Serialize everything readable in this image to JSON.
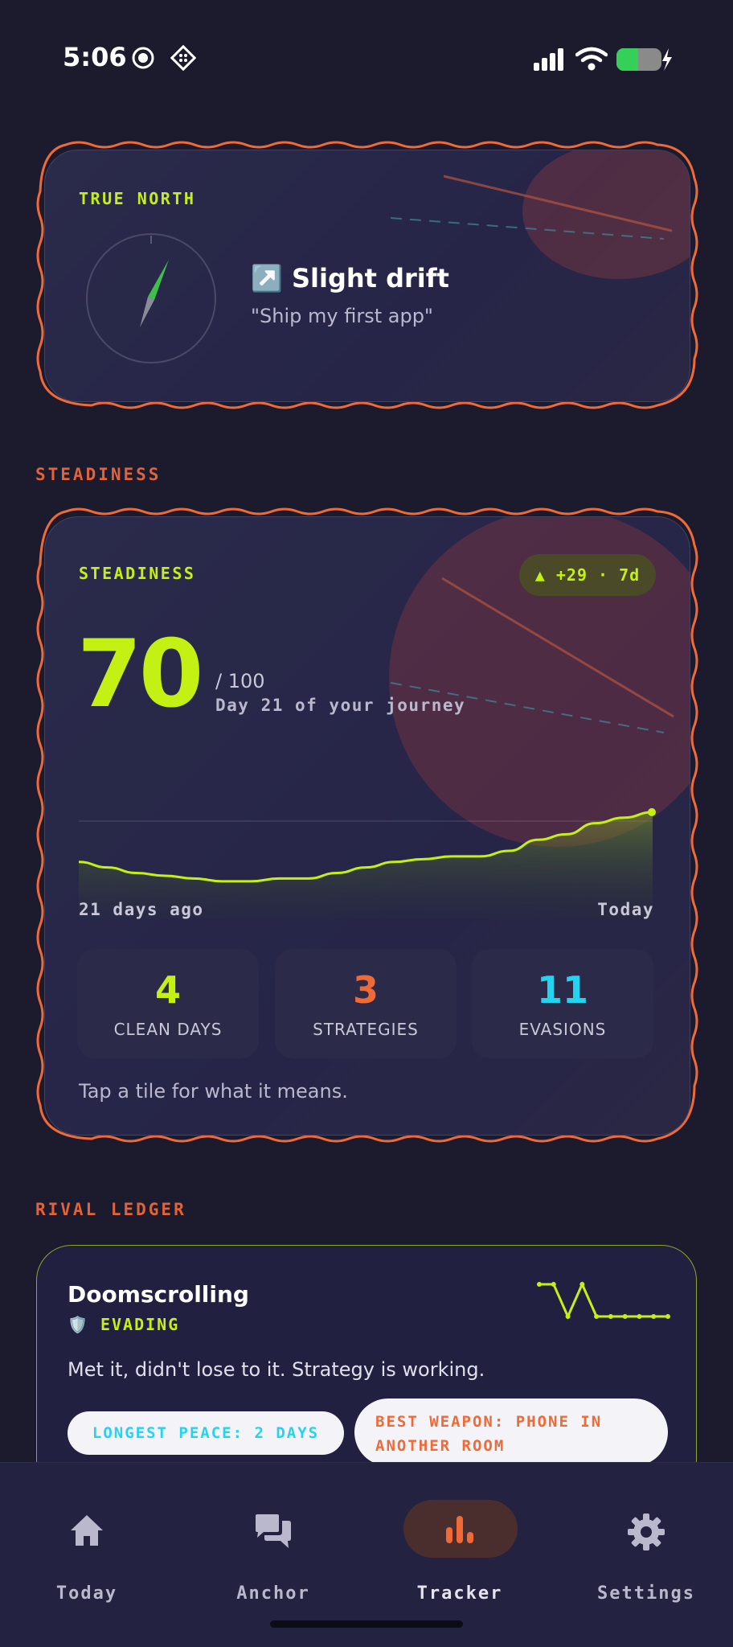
{
  "status": {
    "time": "5:06"
  },
  "north": {
    "label": "TRUE NORTH",
    "drift_icon": "↗️",
    "drift": "Slight drift",
    "goal": "\"Ship my first app\""
  },
  "steadiness_section": "STEADINESS",
  "steadiness": {
    "label": "STEADINESS",
    "delta": "▲ +29 · 7d",
    "score": "70",
    "max": "/ 100",
    "day_text": "Day 21 of your journey",
    "range_start": "21 days ago",
    "range_end": "Today",
    "tiles": [
      {
        "value": "4",
        "label": "CLEAN DAYS",
        "color": "#c4f014"
      },
      {
        "value": "3",
        "label": "STRATEGIES",
        "color": "#f06a38"
      },
      {
        "value": "11",
        "label": "EVASIONS",
        "color": "#22d4f0"
      }
    ],
    "hint": "Tap a tile for what it means."
  },
  "chart_data": {
    "type": "area",
    "series": [
      {
        "values": [
          52,
          50,
          48,
          47,
          46,
          45,
          45,
          46,
          46,
          48,
          50,
          52,
          53,
          54,
          54,
          56,
          60,
          62,
          66,
          68,
          70
        ]
      }
    ],
    "ylim": [
      0,
      100
    ]
  },
  "rival_section": "RIVAL LEDGER",
  "rival": {
    "name": "Doomscrolling",
    "status_icon": "🛡️",
    "status": "EVADING",
    "description": "Met it, didn't lose to it. Strategy is working.",
    "pill_peace": "LONGEST PEACE: 2 DAYS",
    "pill_weapon_line1": "BEST WEAPON: PHONE IN",
    "pill_weapon_line2": "ANOTHER ROOM",
    "sparkline": [
      3,
      3,
      1,
      3,
      1,
      1,
      1,
      1,
      1,
      1
    ]
  },
  "nav": {
    "items": [
      {
        "label": "Today",
        "icon": "home-icon"
      },
      {
        "label": "Anchor",
        "icon": "chat-icon"
      },
      {
        "label": "Tracker",
        "icon": "bar-chart-icon",
        "active": true
      },
      {
        "label": "Settings",
        "icon": "gear-icon"
      }
    ]
  },
  "colors": {
    "accent_lime": "#c4f014",
    "accent_orange": "#f06a38",
    "accent_cyan": "#22d4f0",
    "background": "#1c1b2e"
  }
}
